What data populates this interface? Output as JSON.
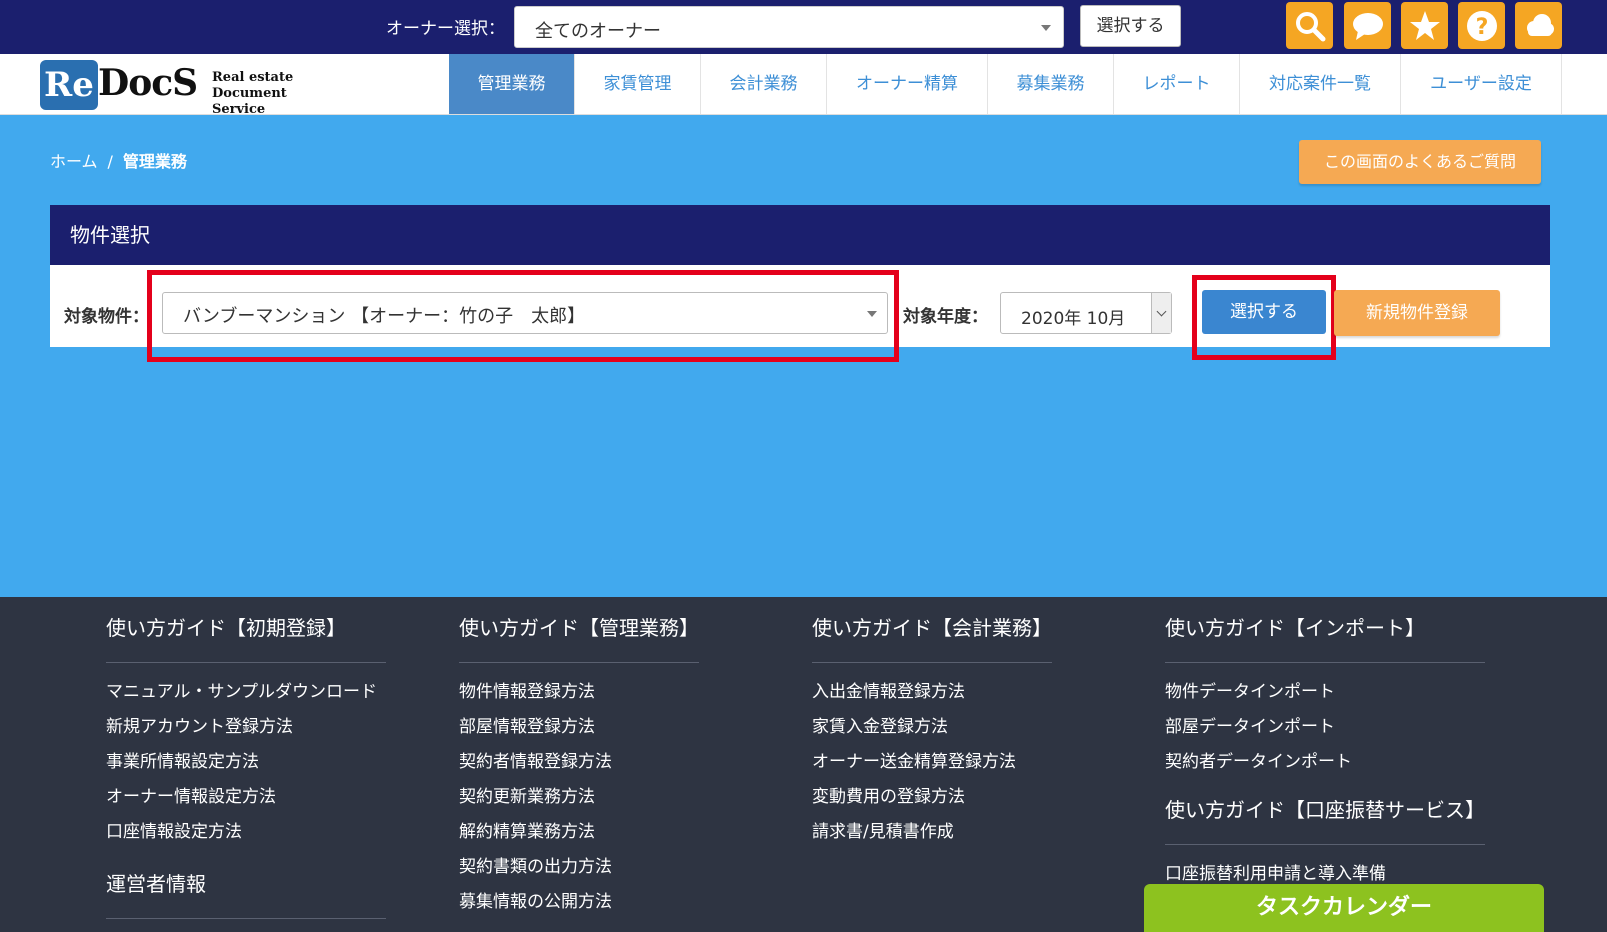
{
  "topbar": {
    "owner_label": "オーナー選択：",
    "owner_select_value": "全てのオーナー",
    "select_button": "選択する",
    "icons": [
      "search-icon",
      "chat-icon",
      "star-icon",
      "help-icon",
      "cloud-icon"
    ],
    "icon_color": "#f5a623"
  },
  "logo": {
    "re": "Re",
    "docs": "DocS",
    "line1": "Real estate",
    "line2": "Document Service"
  },
  "nav": {
    "tabs": [
      {
        "label": "管理業務",
        "active": true
      },
      {
        "label": "家賃管理"
      },
      {
        "label": "会計業務"
      },
      {
        "label": "オーナー精算"
      },
      {
        "label": "募集業務"
      },
      {
        "label": "レポート"
      },
      {
        "label": "対応案件一覧"
      },
      {
        "label": "ユーザー設定"
      }
    ]
  },
  "breadcrumb": {
    "home": "ホーム",
    "separator": "/",
    "current": "管理業務"
  },
  "faq_button": "この画面のよくあるご質問",
  "panel": {
    "title": "物件選択",
    "property_label": "対象物件：",
    "property_value": "バンブーマンション 【オーナー：竹の子　太郎】",
    "year_label": "対象年度：",
    "year_value": "2020年 10月",
    "select_button": "選択する",
    "new_property_button": "新規物件登録"
  },
  "footer": {
    "columns": [
      {
        "sections": [
          {
            "heading": "使い方ガイド【初期登録】",
            "links": [
              "マニュアル・サンプルダウンロード",
              "新規アカウント登録方法",
              "事業所情報設定方法",
              "オーナー情報設定方法",
              "口座情報設定方法"
            ]
          },
          {
            "heading": "運営者情報",
            "links": []
          }
        ]
      },
      {
        "sections": [
          {
            "heading": "使い方ガイド【管理業務】",
            "links": [
              "物件情報登録方法",
              "部屋情報登録方法",
              "契約者情報登録方法",
              "契約更新業務方法",
              "解約精算業務方法",
              "契約書類の出力方法",
              "募集情報の公開方法"
            ]
          }
        ]
      },
      {
        "sections": [
          {
            "heading": "使い方ガイド【会計業務】",
            "links": [
              "入出金情報登録方法",
              "家賃入金登録方法",
              "オーナー送金精算登録方法",
              "変動費用の登録方法",
              "請求書/見積書作成"
            ]
          }
        ]
      },
      {
        "sections": [
          {
            "heading": "使い方ガイド【インポート】",
            "links": [
              "物件データインポート",
              "部屋データインポート",
              "契約者データインポート"
            ]
          },
          {
            "heading": "使い方ガイド【口座振替サービス】",
            "links": [
              "口座振替利用申請と導入準備"
            ]
          }
        ]
      }
    ]
  },
  "task_calendar_button": "タスクカレンダー"
}
